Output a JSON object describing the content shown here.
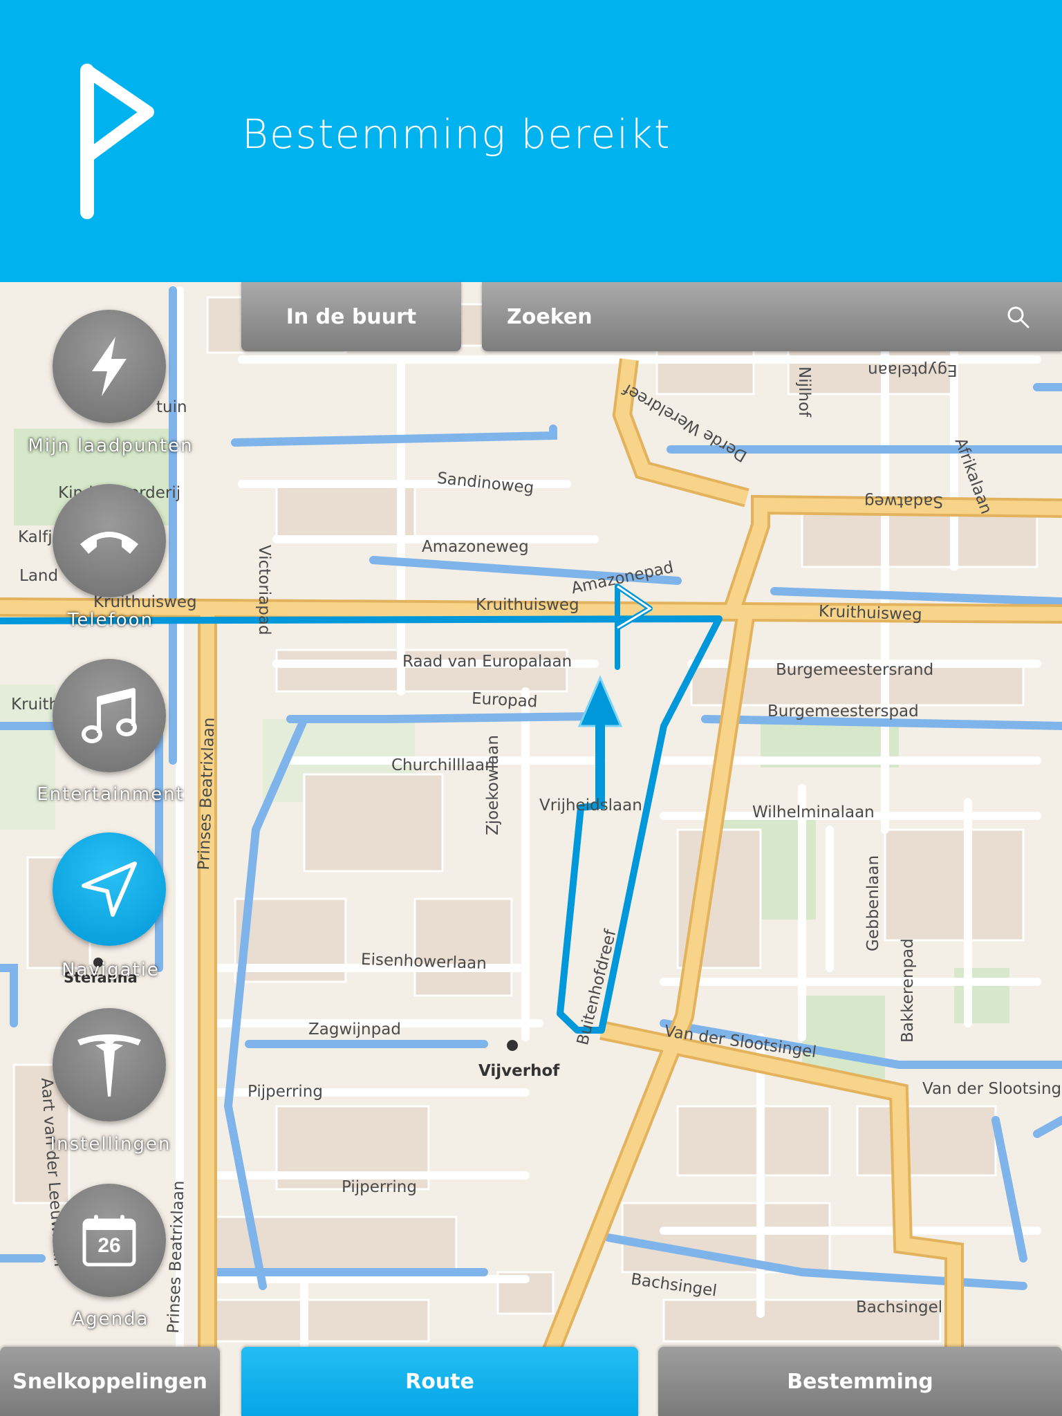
{
  "banner": {
    "title": "Bestemming bereikt",
    "icon": "destination-flag-icon"
  },
  "top_bar": {
    "nearby_label": "In de buurt",
    "search_label": "Zoeken",
    "search_icon": "search-icon"
  },
  "sidebar": [
    {
      "label": "Mijn laadpunten",
      "icon": "lightning-icon"
    },
    {
      "label": "Telefoon",
      "icon": "phone-icon"
    },
    {
      "label": "Entertainment",
      "icon": "music-note-icon"
    },
    {
      "label": "Navigatie",
      "icon": "navigation-arrow-icon"
    },
    {
      "label": "Instellingen",
      "icon": "tesla-logo-icon"
    },
    {
      "label": "Agenda",
      "icon": "calendar-icon",
      "date": "26"
    }
  ],
  "bottom_bar": {
    "shortcuts_label": "Snelkoppelingen",
    "route_label": "Route",
    "destination_label": "Bestemming"
  },
  "map": {
    "streets": [
      "Egyptelaan",
      "Nijlhof",
      "Afrikalaan",
      "Sadatweg",
      "Derde Wereldreef",
      "Sandinoweg",
      "Amazoneweg",
      "Amazonepad",
      "Kruithuisweg",
      "Kruithuisweg",
      "Kruithuisweg",
      "Victoriapad",
      "Raad van Europalaan",
      "Burgemeestersrand",
      "Europad",
      "Burgemeesterspad",
      "Churchilllaan",
      "Vrijheidslaan",
      "Wilhelminalaan",
      "Zjoekowlaan",
      "Gebbenlaan",
      "Bakkerenpad",
      "Eisenhowerlaan",
      "Zagwijnpad",
      "Van der Slootsingel",
      "Van der Slootsingel",
      "Pijperring",
      "Pijperring",
      "Bachsingel",
      "Bachsingel",
      "Prinses Beatrixlaan",
      "Prinses Beatrixlaan",
      "Aart van der Leeuwlaan",
      "Buitenhofdreef",
      "tuin",
      "Kinderboerderij",
      "Kalfj",
      "Land",
      "Kruith",
      "Stefanna"
    ],
    "pois": [
      "Vijverhof"
    ],
    "colors": {
      "route": "#00a0e6",
      "water": "#7fb4ea",
      "major_road": "#f5c96b",
      "park": "#d6e8c9"
    }
  }
}
